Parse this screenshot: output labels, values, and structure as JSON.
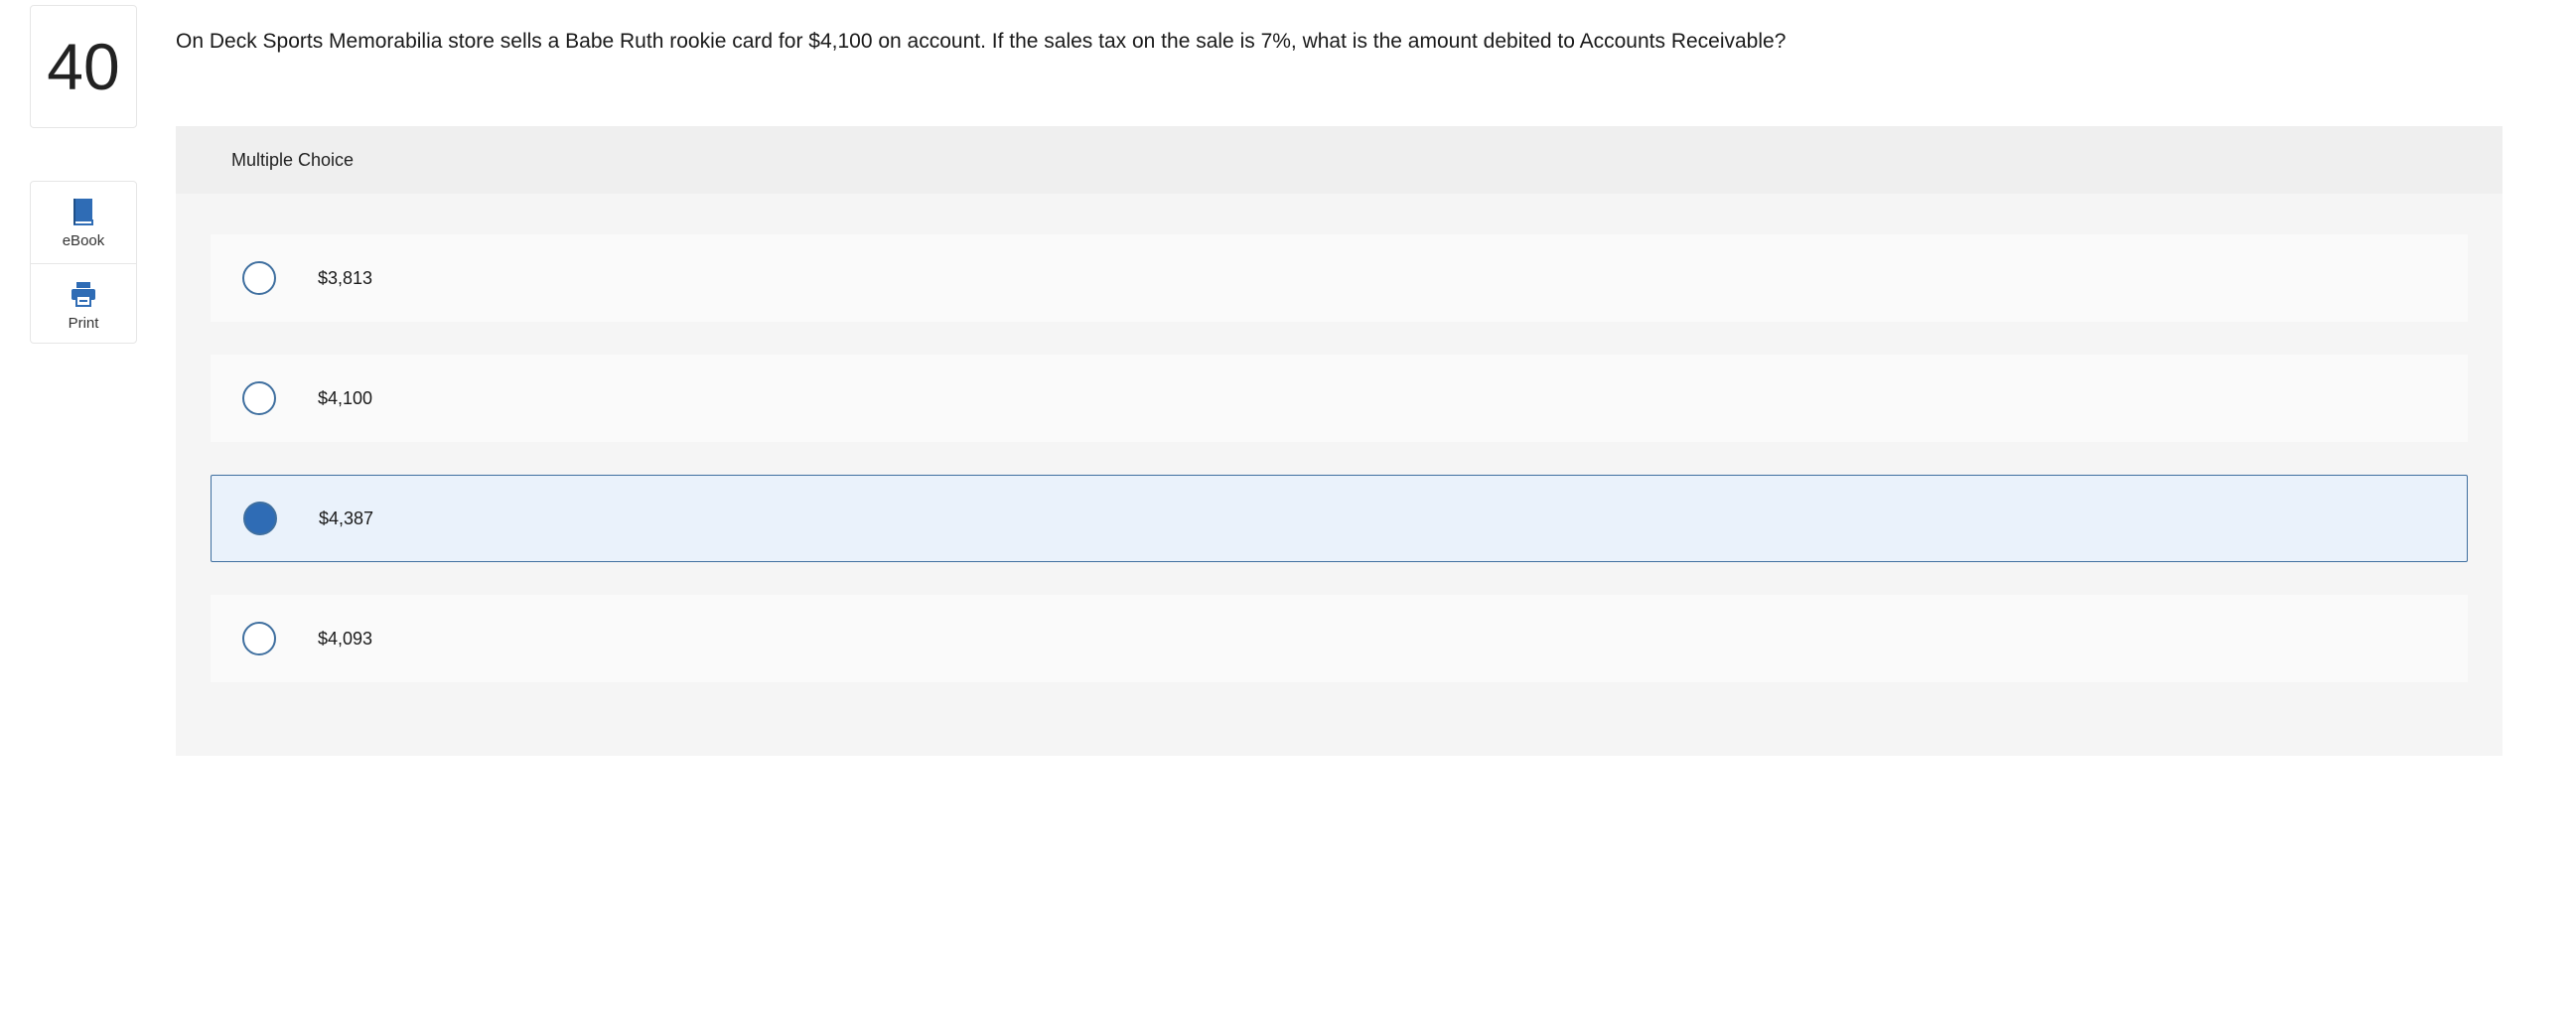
{
  "question_number": "40",
  "tools": [
    {
      "label": "eBook",
      "icon": "book-icon",
      "color": "#2f6cb5"
    },
    {
      "label": "Print",
      "icon": "printer-icon",
      "color": "#2f6cb5"
    }
  ],
  "question_text": "On Deck Sports Memorabilia store sells a Babe Ruth rookie card for $4,100 on account. If the sales tax on the sale is 7%, what is the amount debited to Accounts Receivable?",
  "answer_panel": {
    "header": "Multiple Choice",
    "options": [
      {
        "text": "$3,813",
        "selected": false
      },
      {
        "text": "$4,100",
        "selected": false
      },
      {
        "text": "$4,387",
        "selected": true
      },
      {
        "text": "$4,093",
        "selected": false
      }
    ]
  },
  "colors": {
    "accent": "#2f6cb5",
    "selected_background": "#eaf2fb",
    "panel_background": "#f5f5f5"
  }
}
